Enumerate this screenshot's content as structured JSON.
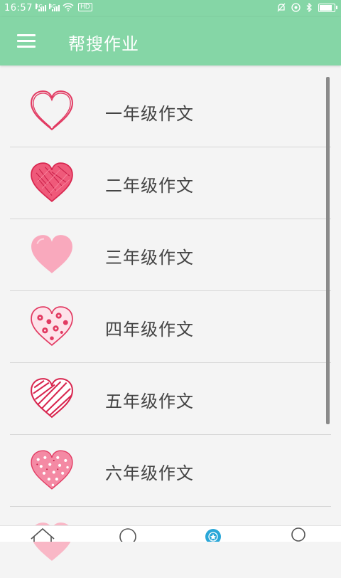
{
  "status_bar": {
    "time": "16:57",
    "network_1": "4G",
    "network_2": "4G",
    "hd_badge": "HD",
    "battery_level": 0.85
  },
  "app_bar": {
    "title": "帮搜作业",
    "menu_icon": "hamburger-menu-icon"
  },
  "grades": [
    {
      "label": "一年级作文",
      "icon": "outline-heart-icon"
    },
    {
      "label": "二年级作文",
      "icon": "scribble-heart-icon"
    },
    {
      "label": "三年级作文",
      "icon": "pink-heart-icon"
    },
    {
      "label": "四年级作文",
      "icon": "dotted-heart-icon"
    },
    {
      "label": "五年级作文",
      "icon": "striped-heart-icon"
    },
    {
      "label": "六年级作文",
      "icon": "patterned-heart-icon"
    }
  ],
  "bottom_nav": {
    "items": [
      "home-icon",
      "circle-icon",
      "star-badge-icon",
      "profile-icon"
    ],
    "active_color": "#2aa7d8"
  },
  "colors": {
    "accent": "#85d6a6",
    "heart": "#e23a62"
  }
}
